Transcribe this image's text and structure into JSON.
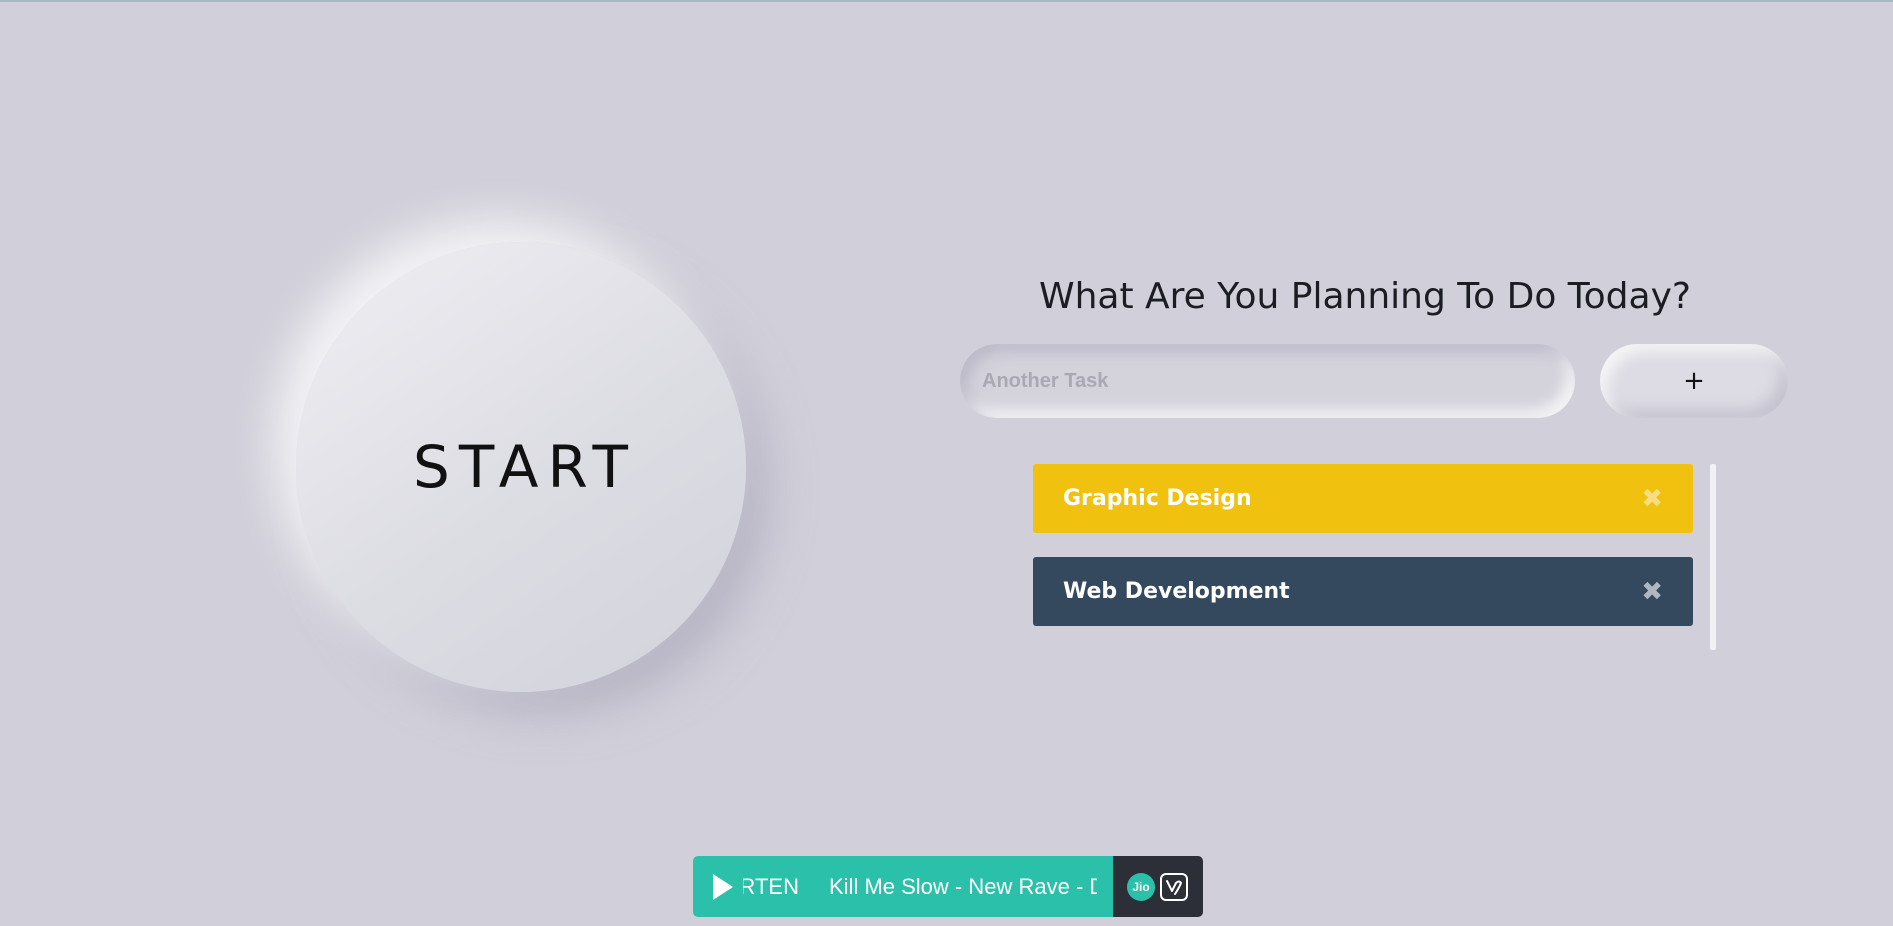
{
  "start_button": {
    "label": "START"
  },
  "planner": {
    "title": "What Are You Planning To Do Today?",
    "input_placeholder": "Another Task",
    "input_value": "",
    "add_button_label": "+",
    "delete_icon_glyph": "✖",
    "tasks": [
      {
        "label": "Graphic Design",
        "color": "#f0c20f"
      },
      {
        "label": "Web Development",
        "color": "#34495e"
      }
    ]
  },
  "player": {
    "station_text": "RTEN",
    "track_text": "Kill Me Slow - New Rave - D",
    "brand_text": "Jio",
    "accent_color": "#2bc0aa",
    "brand_bg_color": "#2c2f38",
    "icons": [
      "play-icon",
      "jio-logo",
      "jiosaavn-logo"
    ]
  },
  "colors": {
    "background": "#d1cfd9",
    "text_dark": "#1b1d22"
  }
}
